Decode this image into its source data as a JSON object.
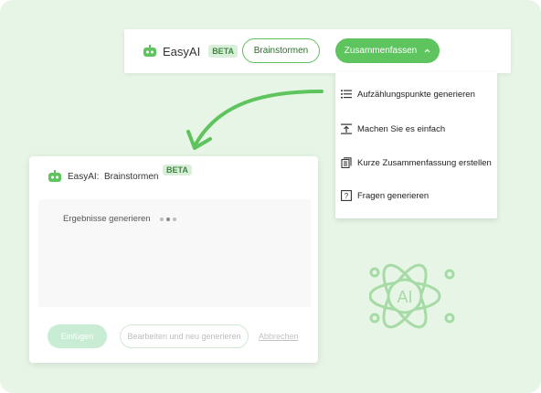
{
  "toolbar": {
    "app_name": "EasyAI",
    "beta_label": "BETA",
    "brainstorm_label": "Brainstormen",
    "summarize_label": "Zusammenfassen",
    "summarize_icon": "chevron-up-icon"
  },
  "dropdown": {
    "items": [
      {
        "label": "Aufzählungspunkte generieren",
        "icon": "list-icon"
      },
      {
        "label": "Machen Sie es einfach",
        "icon": "simplify-icon"
      },
      {
        "label": "Kurze Zusammenfassung erstellen",
        "icon": "document-icon"
      },
      {
        "label": "Fragen generieren",
        "icon": "question-icon"
      }
    ]
  },
  "card": {
    "title": "EasyAI:  Brainstormen",
    "beta_label": "BETA",
    "status": "Ergebnisse generieren",
    "insert_label": "Einfügen",
    "edit_label": "Bearbeiten und neu generieren",
    "cancel_label": "Abbrechen"
  },
  "decoration": {
    "atom_label": "AI"
  },
  "colors": {
    "accent": "#5ec45e",
    "background": "#e7f5e7",
    "beta_bg": "#d9efd9"
  }
}
